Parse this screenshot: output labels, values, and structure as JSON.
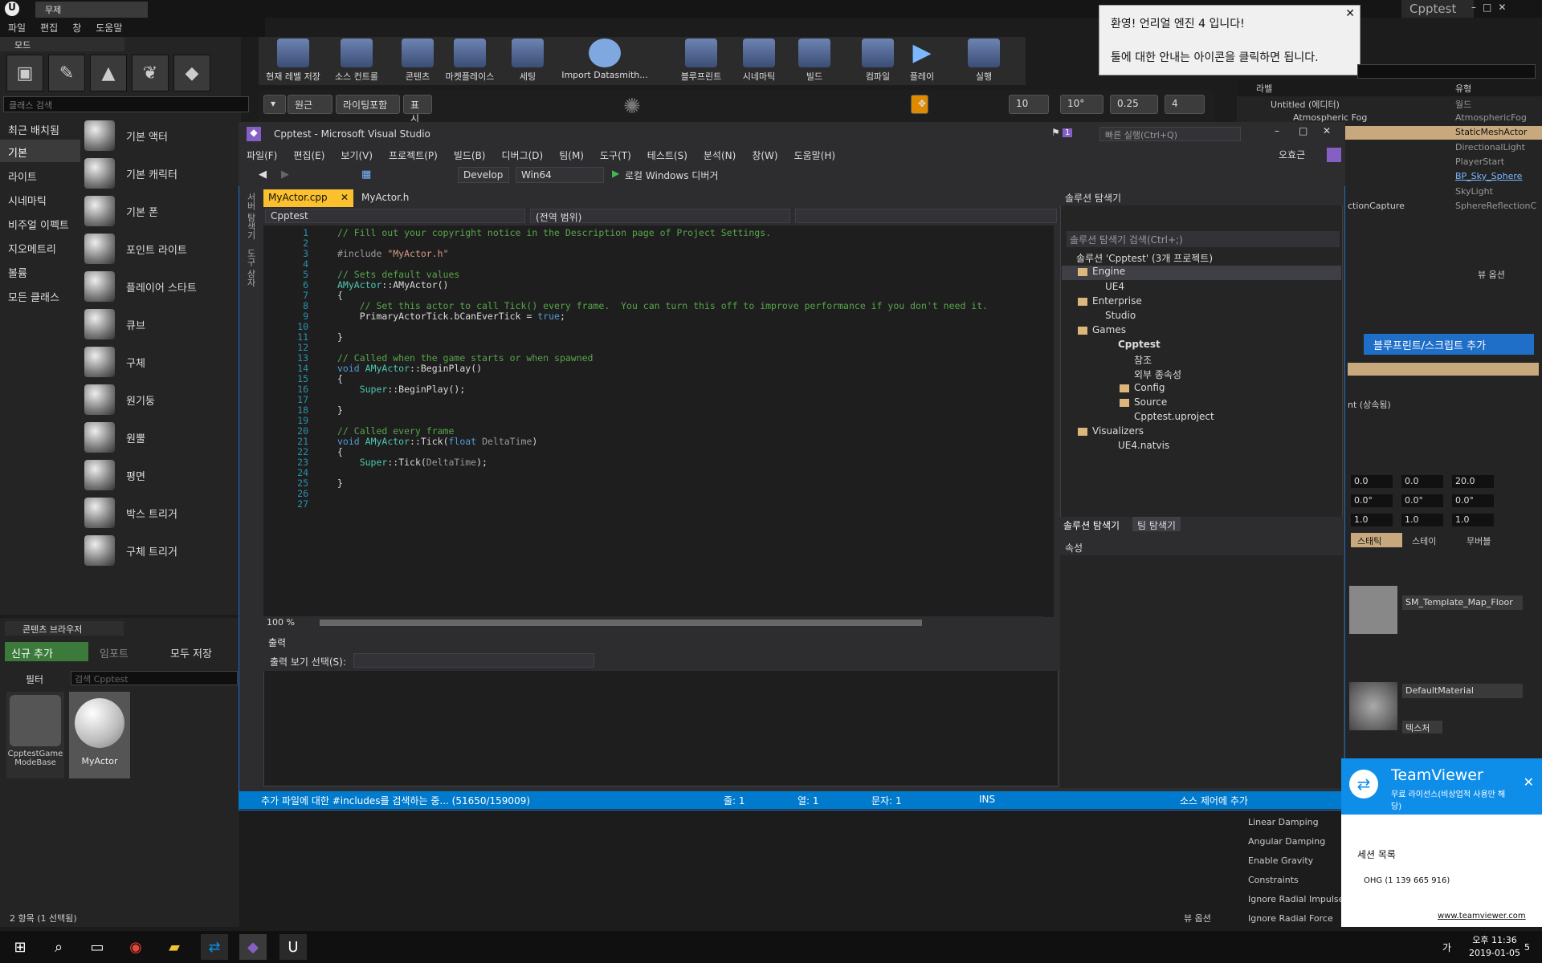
{
  "ue": {
    "logo": "U",
    "tab": "무제",
    "window_title": "Cpptest",
    "menu": [
      "파일",
      "편집",
      "창",
      "도움말"
    ],
    "modes_tab": "모드",
    "class_search_placeholder": "클래스 검색",
    "categories": [
      "최근 배치됨",
      "기본",
      "라이트",
      "시네마틱",
      "비주얼 이펙트",
      "지오메트리",
      "볼륨",
      "모든 클래스"
    ],
    "placeables": [
      "기본 액터",
      "기본 캐릭터",
      "기본 폰",
      "포인트 라이트",
      "플레이어 스타트",
      "큐브",
      "구체",
      "원기둥",
      "원뿔",
      "평면",
      "박스 트리거",
      "구체 트리거"
    ],
    "toolbar": [
      "현재 레벨 저장",
      "소스 컨트롤",
      "콘텐츠",
      "마켓플레이스",
      "세팅",
      "Import Datasmith...",
      "블루프린트",
      "시네마틱",
      "빌드",
      "컴파일",
      "플레이",
      "실행"
    ],
    "viewport": {
      "perspective": "원근",
      "lit": "라이팅포함",
      "show": "표시",
      "snap_grid": "10",
      "snap_rot": "10°",
      "snap_scale": "0.25",
      "cam_speed": "4"
    },
    "outliner": {
      "col_label": "라벨",
      "col_type": "유형",
      "rows": [
        [
          "Untitled (에디터)",
          "월드"
        ],
        [
          "Atmospheric Fog",
          "AtmosphericFog"
        ],
        [
          "",
          "StaticMeshActor"
        ],
        [
          "",
          "DirectionalLight"
        ],
        [
          "",
          "PlayerStart"
        ],
        [
          "",
          "BP_Sky_Sphere"
        ],
        [
          "",
          "SkyLight"
        ],
        [
          "ctionCapture",
          "SphereReflectionC"
        ]
      ],
      "view_options": "뷰 옵션"
    },
    "details": {
      "add_blueprint": "블루프린트/스크립트 추가",
      "inherited": "nt (상속됨)",
      "loc": [
        "0.0",
        "0.0",
        "20.0"
      ],
      "rot": [
        "0.0°",
        "0.0°",
        "0.0°"
      ],
      "scale": [
        "1.0",
        "1.0",
        "1.0"
      ],
      "mobility": [
        "스태틱",
        "스테이",
        "무버블"
      ],
      "mesh": "SM_Template_Map_Floor",
      "material": "DefaultMaterial",
      "texture_btn": "텍스처",
      "physics": [
        "Linear Damping",
        "Angular Damping",
        "Enable Gravity",
        "Constraints",
        "Ignore Radial Impulse",
        "Ignore Radial Force"
      ],
      "view_options": "뷰 옵션"
    },
    "content_browser": {
      "tab": "콘텐츠 브라우저",
      "add_new": "신규 추가",
      "import": "임포트",
      "save_all": "모두 저장",
      "filter": "필터",
      "search_placeholder": "검색 Cpptest",
      "assets": [
        "CpptestGame ModeBase",
        "MyActor"
      ],
      "status": "2 항목 (1 선택됨)",
      "view_options": "뷰 옵션"
    }
  },
  "toast": {
    "title": "환영! 언리얼 엔진 4 입니다!",
    "body": "툴에 대한 안내는 아이콘을 클릭하면 됩니다."
  },
  "vs": {
    "title": "Cpptest - Microsoft Visual Studio",
    "quick_launch": "빠른 실행(Ctrl+Q)",
    "notif_count": "1",
    "user": "오효근",
    "menu": [
      "파일(F)",
      "편집(E)",
      "보기(V)",
      "프로젝트(P)",
      "빌드(B)",
      "디버그(D)",
      "팀(M)",
      "도구(T)",
      "테스트(S)",
      "분석(N)",
      "창(W)",
      "도움말(H)"
    ],
    "config": "Develop",
    "platform": "Win64",
    "run": "로컬 Windows 디버거",
    "side_tabs": [
      "서버 탐색기",
      "도구 상자"
    ],
    "tabs": [
      "MyActor.cpp",
      "MyActor.h"
    ],
    "nav": [
      "Cpptest",
      "(전역 범위)",
      ""
    ],
    "code": [
      {
        "n": "1",
        "t": "// Fill out your copyright notice in the Description page of Project Settings.",
        "c": "cm"
      },
      {
        "n": "2",
        "t": "",
        "c": ""
      },
      {
        "n": "3",
        "t": "#include \"MyActor.h\"",
        "c": "inc"
      },
      {
        "n": "4",
        "t": "",
        "c": ""
      },
      {
        "n": "5",
        "t": "// Sets default values",
        "c": "cm"
      },
      {
        "n": "6",
        "t": "AMyActor::AMyActor()",
        "c": "ctor"
      },
      {
        "n": "7",
        "t": "{",
        "c": ""
      },
      {
        "n": "8",
        "t": "    // Set this actor to call Tick() every frame.  You can turn this off to improve performance if you don't need it.",
        "c": "cm"
      },
      {
        "n": "9",
        "t": "    PrimaryActorTick.bCanEverTick = true;",
        "c": "tru"
      },
      {
        "n": "10",
        "t": "",
        "c": ""
      },
      {
        "n": "11",
        "t": "}",
        "c": ""
      },
      {
        "n": "12",
        "t": "",
        "c": ""
      },
      {
        "n": "13",
        "t": "// Called when the game starts or when spawned",
        "c": "cm"
      },
      {
        "n": "14",
        "t": "void AMyActor::BeginPlay()",
        "c": "fn"
      },
      {
        "n": "15",
        "t": "{",
        "c": ""
      },
      {
        "n": "16",
        "t": "    Super::BeginPlay();",
        "c": "sup"
      },
      {
        "n": "17",
        "t": "",
        "c": ""
      },
      {
        "n": "18",
        "t": "}",
        "c": ""
      },
      {
        "n": "19",
        "t": "",
        "c": ""
      },
      {
        "n": "20",
        "t": "// Called every frame",
        "c": "cm"
      },
      {
        "n": "21",
        "t": "void AMyActor::Tick(float DeltaTime)",
        "c": "tick"
      },
      {
        "n": "22",
        "t": "{",
        "c": ""
      },
      {
        "n": "23",
        "t": "    Super::Tick(DeltaTime);",
        "c": "sup"
      },
      {
        "n": "24",
        "t": "",
        "c": ""
      },
      {
        "n": "25",
        "t": "}",
        "c": ""
      },
      {
        "n": "26",
        "t": "",
        "c": ""
      },
      {
        "n": "27",
        "t": "",
        "c": ""
      }
    ],
    "zoom": "100 %",
    "output": {
      "title": "출력",
      "label": "출력 보기 선택(S):"
    },
    "solution": {
      "title": "솔루션 탐색기",
      "search": "솔루션 탐색기 검색(Ctrl+;)",
      "tree": [
        "솔루션 'Cpptest' (3개 프로젝트)",
        "Engine",
        "UE4",
        "Enterprise",
        "Studio",
        "Games",
        "Cpptest",
        "참조",
        "외부 종속성",
        "Config",
        "Source",
        "Cpptest.uproject",
        "Visualizers",
        "UE4.natvis"
      ],
      "tabs": [
        "솔루션 탐색기",
        "팀 탐색기"
      ]
    },
    "properties": {
      "title": "속성"
    },
    "status": {
      "msg": "추가 파일에 대한 #includes를 검색하는 중... (51650/159009)",
      "line": "줄: 1",
      "col": "열: 1",
      "ch": "문자: 1",
      "ins": "INS",
      "scm": "소스 제어에 추가"
    }
  },
  "teamviewer": {
    "title": "TeamViewer",
    "license": "무료 라이선스(비상업적 사용만 해당)",
    "sessions": "세션 목록",
    "session_item": "OHG (1 139 665 916)",
    "link": "www.teamviewer.com"
  },
  "taskbar": {
    "time": "오후 11:36",
    "date": "2019-01-05",
    "ime": "가",
    "notif": "5"
  }
}
